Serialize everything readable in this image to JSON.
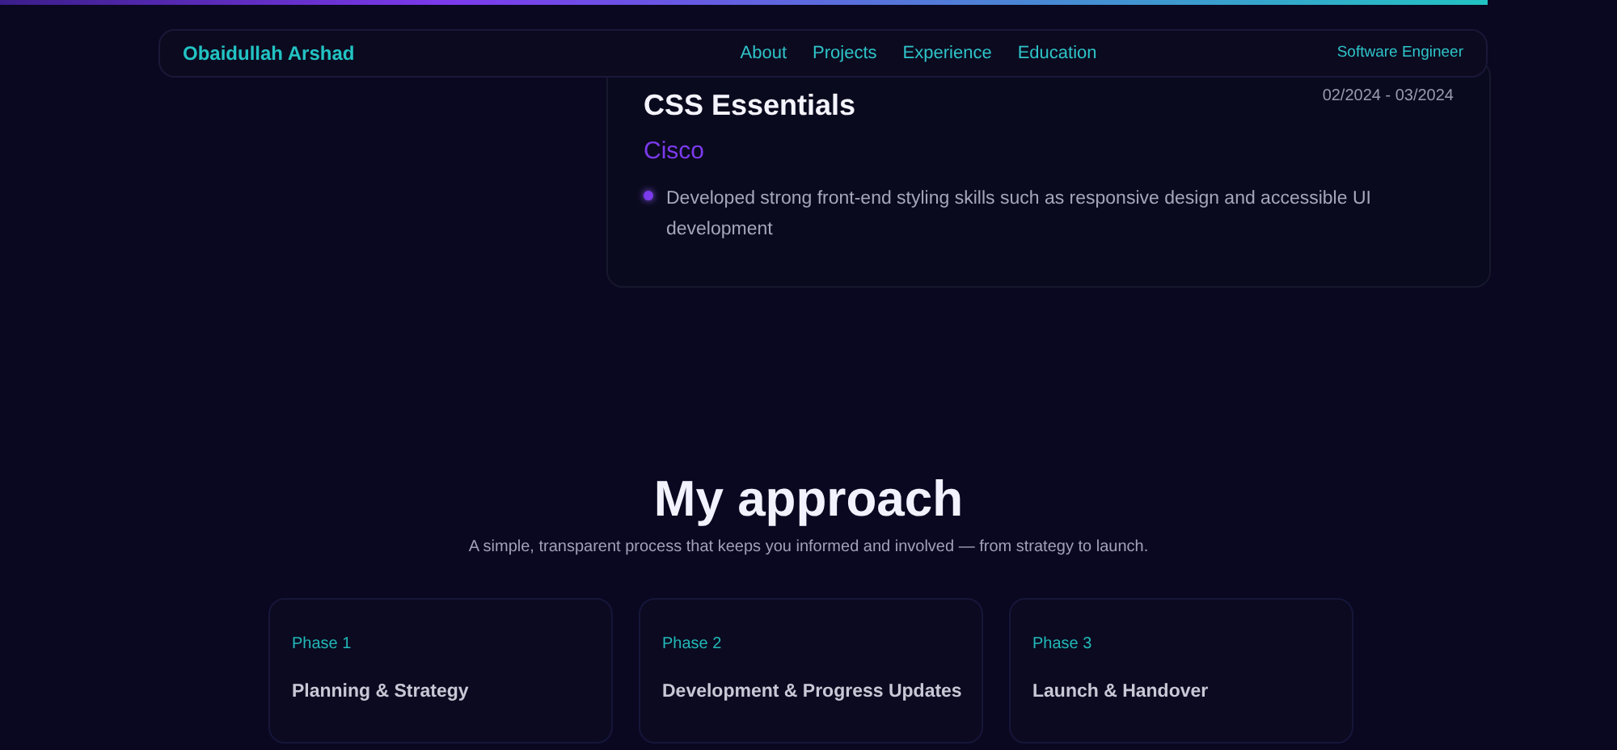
{
  "navbar": {
    "brand": "Obaidullah Arshad",
    "links": [
      {
        "label": "About"
      },
      {
        "label": "Projects"
      },
      {
        "label": "Experience"
      },
      {
        "label": "Education"
      }
    ],
    "role": "Software Engineer"
  },
  "certificate": {
    "title": "CSS Essentials",
    "issuer": "Cisco",
    "dates": "02/2024 - 03/2024",
    "bullets": [
      "Developed strong front-end styling skills such as responsive design and accessible UI development"
    ]
  },
  "approach": {
    "title": "My approach",
    "subtitle": "A simple, transparent process that keeps you informed and involved — from strategy to launch.",
    "phases": [
      {
        "label": "Phase 1",
        "title": "Planning & Strategy"
      },
      {
        "label": "Phase 2",
        "title": "Development & Progress Updates"
      },
      {
        "label": "Phase 3",
        "title": "Launch & Handover"
      }
    ]
  }
}
